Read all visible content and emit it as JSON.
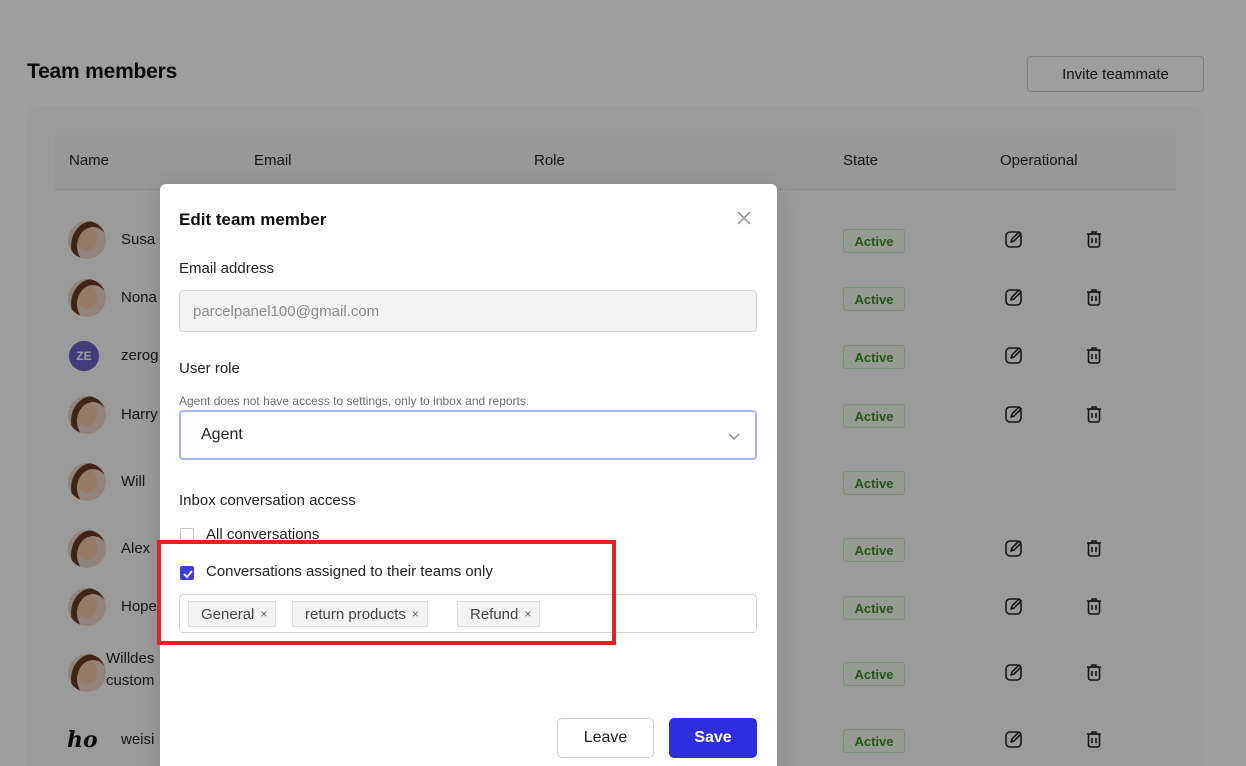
{
  "page": {
    "title": "Team members",
    "invite_label": "Invite teammate"
  },
  "table": {
    "columns": [
      "Name",
      "Email",
      "Role",
      "State",
      "Operational"
    ],
    "rows": [
      {
        "name": "Susa",
        "avatar": "photo",
        "state": "Active",
        "actions": true
      },
      {
        "name": "Nona",
        "avatar": "photo",
        "state": "Active",
        "actions": true
      },
      {
        "name": "zerog",
        "avatar": "initials",
        "initials": "ZE",
        "state": "Active",
        "actions": true
      },
      {
        "name": "Harry",
        "avatar": "photo",
        "state": "Active",
        "actions": true
      },
      {
        "name": "Will",
        "avatar": "photo",
        "state": "Active",
        "actions": false
      },
      {
        "name": "Alex",
        "avatar": "photo",
        "state": "Active",
        "actions": true
      },
      {
        "name": "Hope",
        "avatar": "photo",
        "state": "Active",
        "actions": true
      },
      {
        "name": "Willdes custom",
        "name_line1": "Willdes",
        "name_line2": "custom",
        "avatar": "photo",
        "state": "Active",
        "actions": true
      },
      {
        "name": "weisi",
        "avatar": "logo",
        "logo_text": "ho",
        "state": "Active",
        "actions": true
      }
    ]
  },
  "modal": {
    "title": "Edit team member",
    "email_label": "Email address",
    "email_value": "parcelpanel100@gmail.com",
    "role_label": "User role",
    "role_help": "Agent does not have access to settings, only to inbox and reports.",
    "role_value": "Agent",
    "access_label": "Inbox conversation access",
    "option_all": "All conversations",
    "option_teams": "Conversations assigned to their teams only",
    "option_all_checked": false,
    "option_teams_checked": true,
    "teams": [
      "General",
      "return products",
      "Refund"
    ],
    "tag_remove": "×",
    "leave_label": "Leave",
    "save_label": "Save"
  },
  "colors": {
    "primary": "#2e2ee0",
    "highlight": "#ea1f24",
    "active_badge": "#3d8b2a"
  }
}
